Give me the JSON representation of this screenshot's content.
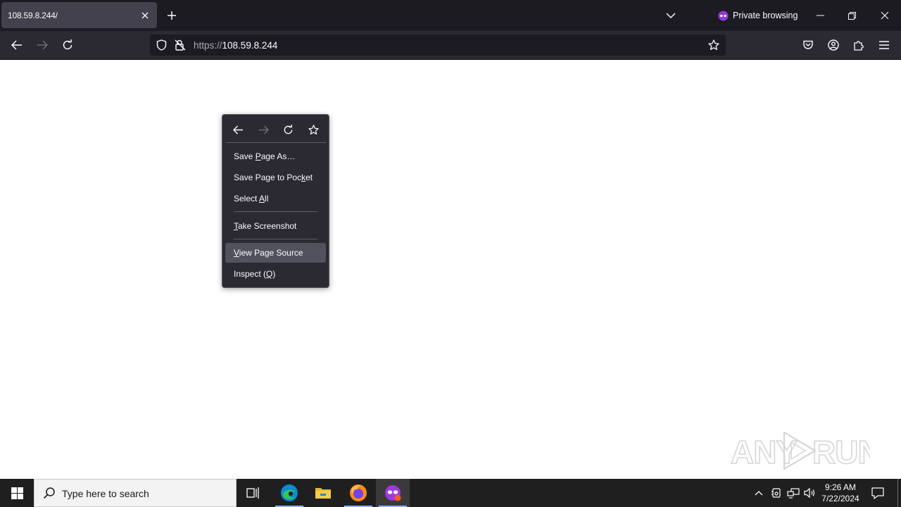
{
  "browser": {
    "tab": {
      "title": "108.59.8.244/"
    },
    "private_label": "Private browsing",
    "url": {
      "scheme": "https://",
      "host": "108.59.8.244"
    }
  },
  "context_menu": {
    "items": [
      {
        "pre": "Save ",
        "key": "P",
        "post": "age As…"
      },
      {
        "pre": "Save Page to Poc",
        "key": "k",
        "post": "et"
      },
      {
        "pre": "Select ",
        "key": "A",
        "post": "ll"
      },
      {
        "pre": "",
        "key": "T",
        "post": "ake Screenshot"
      },
      {
        "pre": "",
        "key": "V",
        "post": "iew Page Source"
      },
      {
        "pre": "Inspect (",
        "key": "Q",
        "post": ")"
      }
    ],
    "highlighted_index": 4
  },
  "watermark": {
    "text": "ANY RUN"
  },
  "taskbar": {
    "search_placeholder": "Type here to search",
    "clock": {
      "time": "9:26 AM",
      "date": "7/22/2024"
    }
  },
  "colors": {
    "tab_strip": "#1c1b22",
    "toolbar": "#2b2a33",
    "private_accent": "#8f3bd6",
    "taskbar": "#1f1f1f"
  }
}
